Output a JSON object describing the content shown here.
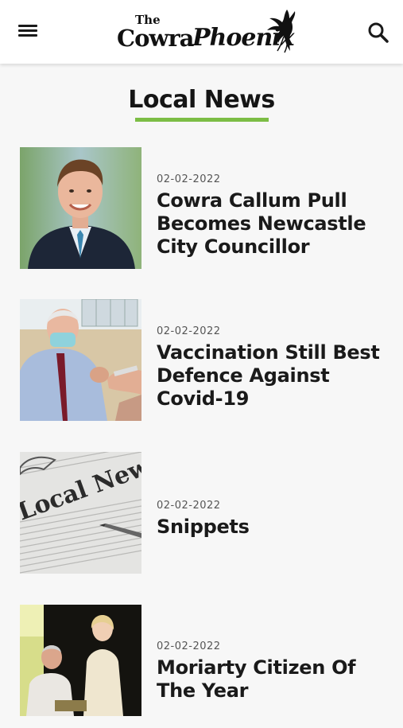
{
  "header": {
    "menu_icon": "hamburger-menu-icon",
    "search_icon": "search-icon",
    "logo": {
      "the": "The",
      "cowra": "Cowra",
      "phoenix": "Phoenix"
    }
  },
  "section": {
    "title": "Local News",
    "accent_color": "#7cbd45"
  },
  "articles": [
    {
      "date": "02-02-2022",
      "title": "Cowra Callum Pull Becomes Newcastle City Councillor"
    },
    {
      "date": "02-02-2022",
      "title": "Vaccination Still Best Defence Against Covid-19"
    },
    {
      "date": "02-02-2022",
      "title": "Snippets",
      "thumb_text": "Local News"
    },
    {
      "date": "02-02-2022",
      "title": "Moriarty Citizen Of The Year"
    }
  ]
}
